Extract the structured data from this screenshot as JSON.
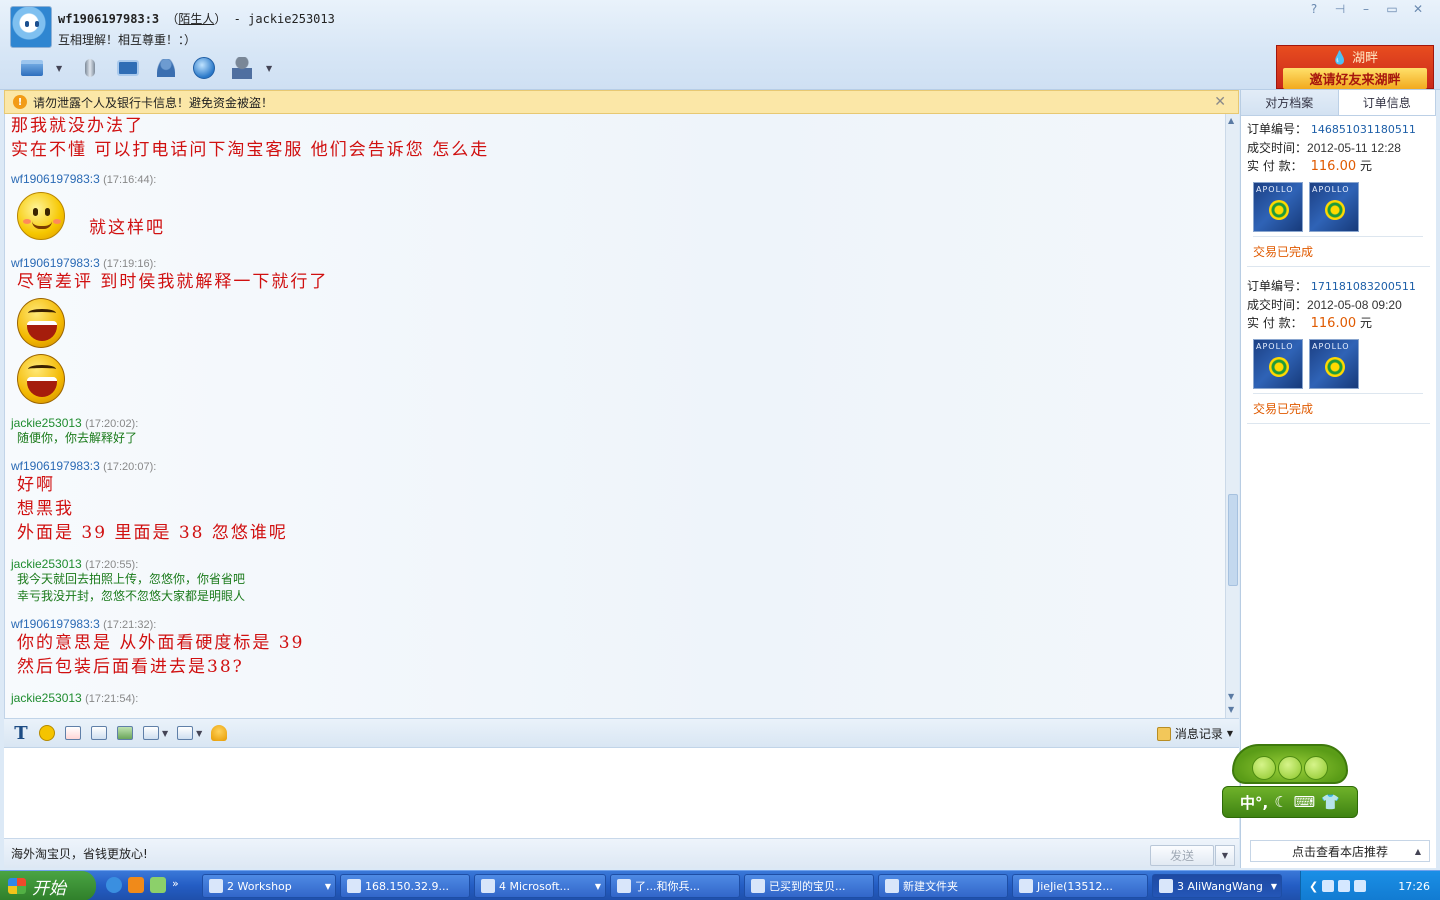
{
  "header": {
    "contact_id": "wf1906197983:3",
    "contact_relation": "陌生人",
    "account": "jackie253013",
    "signature": "互相理解！相互尊重！：）"
  },
  "ad_banner": {
    "top": "湖畔",
    "bottom": "邀请好友来湖畔"
  },
  "warning": {
    "text": "请勿泄露个人及银行卡信息！避免资金被盗！"
  },
  "chat": {
    "messages": [
      {
        "lines": [
          "那我就没办法了",
          "实在不懂 可以打电话问下淘宝客服  他们会告诉您 怎么走"
        ]
      },
      {
        "sender": "wf1906197983:3",
        "time": "(17:16:44):",
        "text": "就这样吧"
      },
      {
        "sender": "wf1906197983:3",
        "time": "(17:19:16):",
        "lines": [
          "尽管差评 到时侯我就解释一下就行了"
        ]
      },
      {
        "sender": "jackie253013",
        "time": "(17:20:02):",
        "lines": [
          "随便你，你去解释好了"
        ]
      },
      {
        "sender": "wf1906197983:3",
        "time": "(17:20:07):",
        "lines": [
          "好啊",
          "想黑我",
          "外面是 39  里面是 38  忽悠谁呢"
        ]
      },
      {
        "sender": "jackie253013",
        "time": "(17:20:55):",
        "lines": [
          "我今天就回去拍照上传，忽悠你，你省省吧",
          "幸亏我没开封，忽悠不忽悠大家都是明眼人"
        ]
      },
      {
        "sender": "wf1906197983:3",
        "time": "(17:21:32):",
        "lines": [
          "你的意思是  从外面看硬度标是 39",
          "然后包装后面看进去是38?"
        ]
      },
      {
        "sender": "jackie253013",
        "time": "(17:21:54):"
      }
    ]
  },
  "input_toolbar": {
    "history_label": "消息记录"
  },
  "status": {
    "ad_text": "海外淘宝贝，省钱更放心!",
    "send_label": "发送"
  },
  "right_panel": {
    "tabs": [
      "对方档案",
      "订单信息"
    ],
    "labels": {
      "order_no": "订单编号：",
      "deal_time": "成交时间：",
      "paid": "实 付 款：",
      "yuan": "元"
    },
    "orders": [
      {
        "order_no": "146851031180511",
        "deal_time": "2012-05-11 12:28",
        "amount": "116.00",
        "brand": "APOLLO",
        "status": "交易已完成"
      },
      {
        "order_no": "171181083200511",
        "deal_time": "2012-05-08 09:20",
        "amount": "116.00",
        "brand": "APOLLO",
        "status": "交易已完成"
      }
    ],
    "ime_label": "中°,",
    "recommend_label": "点击查看本店推荐"
  },
  "taskbar": {
    "start_label": "开始",
    "tasks": [
      {
        "label": "2 Workshop"
      },
      {
        "label": "168.150.32.9..."
      },
      {
        "label": "4 Microsoft..."
      },
      {
        "label": "了...和你兵..."
      },
      {
        "label": "已买到的宝贝..."
      },
      {
        "label": "新建文件夹"
      },
      {
        "label": "JieJie(13512..."
      },
      {
        "label": "3 AliWangWang"
      }
    ],
    "clock": "17:26"
  }
}
